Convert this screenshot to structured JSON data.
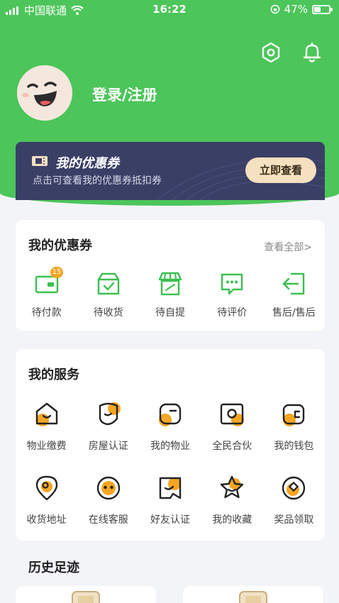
{
  "status_bar": {
    "carrier": "中国联通",
    "time": "16:22",
    "battery": "47%",
    "battery_level": 0.47
  },
  "header": {
    "login_label": "登录/注册",
    "settings_icon": "hexagon-settings-icon",
    "bell_icon": "bell-icon"
  },
  "coupon_banner": {
    "title": "我的优惠券",
    "subtitle": "点击可查看我的优惠券抵扣券",
    "button": "立即查看"
  },
  "orders": {
    "title": "我的优惠券",
    "more": "查看全部>",
    "items": [
      {
        "label": "待付款",
        "icon": "wallet-icon",
        "badge": "15"
      },
      {
        "label": "待收货",
        "icon": "box-check-icon"
      },
      {
        "label": "待自提",
        "icon": "store-icon"
      },
      {
        "label": "待评价",
        "icon": "chat-dots-icon"
      },
      {
        "label": "售后/售后",
        "icon": "return-icon"
      }
    ]
  },
  "services": {
    "title": "我的服务",
    "items": [
      {
        "label": "物业缴费",
        "icon": "home-pay-icon"
      },
      {
        "label": "房屋认证",
        "icon": "house-verify-icon"
      },
      {
        "label": "我的物业",
        "icon": "property-icon"
      },
      {
        "label": "全民合伙",
        "icon": "partner-icon"
      },
      {
        "label": "我的钱包",
        "icon": "wallet-icon"
      },
      {
        "label": "收货地址",
        "icon": "location-icon"
      },
      {
        "label": "在线客服",
        "icon": "support-icon"
      },
      {
        "label": "好友认证",
        "icon": "friend-verify-icon"
      },
      {
        "label": "我的收藏",
        "icon": "star-icon"
      },
      {
        "label": "奖品领取",
        "icon": "prize-icon"
      }
    ]
  },
  "history": {
    "title": "历史足迹"
  },
  "colors": {
    "brand_green": "#4cc55a",
    "accent_orange": "#f5a623",
    "banner_navy": "#3a3f66"
  }
}
